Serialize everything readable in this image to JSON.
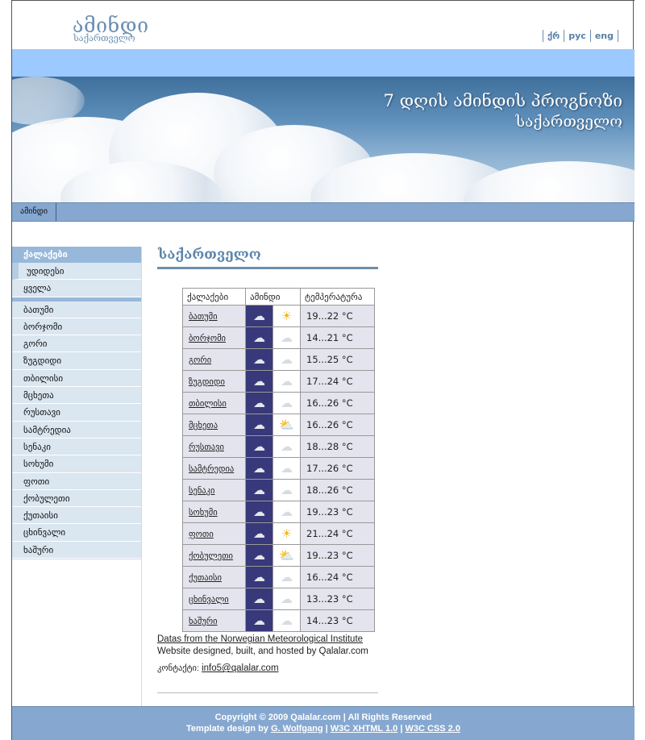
{
  "header": {
    "logo_title": "ამინდი",
    "logo_subtitle": "საქართველო",
    "languages": [
      "ქრ",
      "рус",
      "eng"
    ]
  },
  "banner": {
    "title": "7 დღის ამინდის პროგნოზი",
    "subtitle": "საქართველო"
  },
  "nav": {
    "items": [
      "ამინდი"
    ]
  },
  "sidebar": {
    "heading": "ქალაქები",
    "top_items": [
      "უდიდესი",
      "ყველა"
    ],
    "cities": [
      "ბათუმი",
      "ბორჯომი",
      "გორი",
      "ზუგდიდი",
      "თბილისი",
      "მცხეთა",
      "რუსთავი",
      "სამტრედია",
      "სენაკი",
      "სოხუმი",
      "ფოთი",
      "ქობულეთი",
      "ქუთაისი",
      "ცხინვალი",
      "ხაშური"
    ]
  },
  "main": {
    "title": "საქართველო",
    "table": {
      "headers": [
        "ქალაქები",
        "ამინდი",
        "ტემპერატურა"
      ],
      "rows": [
        {
          "city": "ბათუმი",
          "icon1": "cloud-icon",
          "icon2": "sun-icon",
          "temp": "19...22 °C"
        },
        {
          "city": "ბორჯომი",
          "icon1": "cloud-icon",
          "icon2": "partly-cloudy-icon",
          "temp": "14...21 °C"
        },
        {
          "city": "გორი",
          "icon1": "cloud-icon",
          "icon2": "partly-cloudy-icon",
          "temp": "15...25 °C"
        },
        {
          "city": "ზუგდიდი",
          "icon1": "cloud-icon",
          "icon2": "partly-cloudy-icon",
          "temp": "17...24 °C"
        },
        {
          "city": "თბილისი",
          "icon1": "cloud-icon",
          "icon2": "rain-cloud-icon",
          "temp": "16...26 °C"
        },
        {
          "city": "მცხეთა",
          "icon1": "cloud-icon",
          "icon2": "partly-sunny-icon",
          "temp": "16...26 °C"
        },
        {
          "city": "რუსთავი",
          "icon1": "cloud-icon",
          "icon2": "partly-cloudy-icon",
          "temp": "18...28 °C"
        },
        {
          "city": "სამტრედია",
          "icon1": "cloud-icon",
          "icon2": "partly-cloudy-icon",
          "temp": "17...26 °C"
        },
        {
          "city": "სენაკი",
          "icon1": "cloud-icon",
          "icon2": "partly-cloudy-icon",
          "temp": "18...26 °C"
        },
        {
          "city": "სოხუმი",
          "icon1": "cloud-icon",
          "icon2": "partly-cloudy-icon",
          "temp": "19...23 °C"
        },
        {
          "city": "ფოთი",
          "icon1": "cloud-icon",
          "icon2": "sun-icon",
          "temp": "21...24 °C"
        },
        {
          "city": "ქობულეთი",
          "icon1": "cloud-icon",
          "icon2": "partly-sunny-icon",
          "temp": "19...23 °C"
        },
        {
          "city": "ქუთაისი",
          "icon1": "cloud-icon",
          "icon2": "partly-cloudy-icon",
          "temp": "16...24 °C"
        },
        {
          "city": "ცხინვალი",
          "icon1": "cloud-icon",
          "icon2": "partly-cloudy-icon",
          "temp": "13...23 °C"
        },
        {
          "city": "ხაშური",
          "icon1": "cloud-icon",
          "icon2": "partly-cloudy-icon",
          "temp": "14...23 °C"
        }
      ]
    },
    "credits": {
      "source_link": "Datas from the Norwegian Meteorological Institute",
      "hosted": "Website designed, built, and hosted by Qalalar.com",
      "contact_label": "კონტაქტი:",
      "contact_email": "info5@qalalar.com"
    }
  },
  "footer": {
    "copyright": "Copyright © 2009 Qalalar.com | All Rights Reserved",
    "design_prefix": "Template design by",
    "designer": "G. Wolfgang",
    "xhtml": "W3C XHTML 1.0",
    "css": "W3C CSS 2.0",
    "sep": "|"
  },
  "colors": {
    "accent": "#6b8fb3",
    "band": "#9cc9ff",
    "nav": "#86a8d0",
    "icon_cell": "#38397a"
  }
}
